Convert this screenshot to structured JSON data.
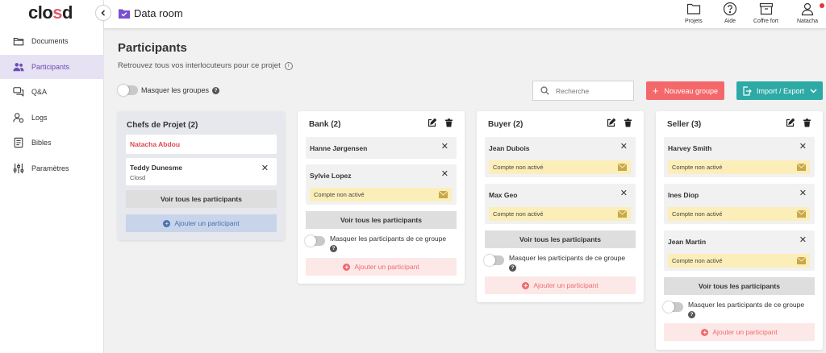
{
  "app": {
    "logo_pre": "clo",
    "logo_accent": "s",
    "logo_post": "d",
    "section_title": "Data room"
  },
  "sidebar": {
    "items": [
      {
        "label": "Documents",
        "icon": "folder-icon",
        "active": false
      },
      {
        "label": "Participants",
        "icon": "users-icon",
        "active": true
      },
      {
        "label": "Q&A",
        "icon": "chat-icon",
        "active": false
      },
      {
        "label": "Logs",
        "icon": "user-log-icon",
        "active": false
      },
      {
        "label": "Bibles",
        "icon": "book-icon",
        "active": false
      },
      {
        "label": "Paramètres",
        "icon": "sliders-icon",
        "active": false
      }
    ]
  },
  "header": {
    "buttons": [
      {
        "label": "Projets",
        "icon": "folder-icon"
      },
      {
        "label": "Aide",
        "icon": "help-icon"
      },
      {
        "label": "Coffre fort",
        "icon": "archive-icon"
      },
      {
        "label": "Natacha",
        "icon": "user-icon"
      }
    ]
  },
  "page": {
    "title": "Participants",
    "subtitle": "Retrouvez tous vos interlocuteurs pour ce projet",
    "mask_groups_label": "Masquer les groupes",
    "search_placeholder": "Recherche",
    "new_group_label": "Nouveau groupe",
    "import_export_label": "Import / Export"
  },
  "groups": [
    {
      "title": "Chefs de Projet (2)",
      "members": [
        {
          "name": "Natacha Abdou",
          "company": "",
          "status": ""
        },
        {
          "name": "Teddy Dunesme",
          "company": "Closd",
          "status": ""
        }
      ],
      "view_all": "Voir tous les participants",
      "add": "Ajouter un participant",
      "mask": ""
    },
    {
      "title": "Bank (2)",
      "members": [
        {
          "name": "Hanne Jørgensen",
          "company": "",
          "status": ""
        },
        {
          "name": "Sylvie Lopez",
          "company": "",
          "status": "Compte non activé"
        }
      ],
      "view_all": "Voir tous les participants",
      "add": "Ajouter un participant",
      "mask": "Masquer les participants de ce groupe"
    },
    {
      "title": "Buyer (2)",
      "members": [
        {
          "name": "Jean Dubois",
          "company": "",
          "status": "Compte non activé"
        },
        {
          "name": "Max Geo",
          "company": "",
          "status": "Compte non activé"
        }
      ],
      "view_all": "Voir tous les participants",
      "add": "Ajouter un participant",
      "mask": "Masquer les participants de ce groupe"
    },
    {
      "title": "Seller (3)",
      "members": [
        {
          "name": "Harvey Smith",
          "company": "",
          "status": "Compte non activé"
        },
        {
          "name": "Ines Diop",
          "company": "",
          "status": "Compte non activé"
        },
        {
          "name": "Jean Martin",
          "company": "",
          "status": "Compte non activé"
        }
      ],
      "view_all": "Voir tous les participants",
      "add": "Ajouter un participant",
      "mask": "Masquer les participants de ce groupe"
    }
  ],
  "colors": {
    "accent_purple": "#6a4fb3",
    "new_group_red": "#f4686b",
    "import_teal": "#2eaaa6",
    "status_yellow": "#fbeeb9",
    "highlight_red": "#e0494f"
  }
}
